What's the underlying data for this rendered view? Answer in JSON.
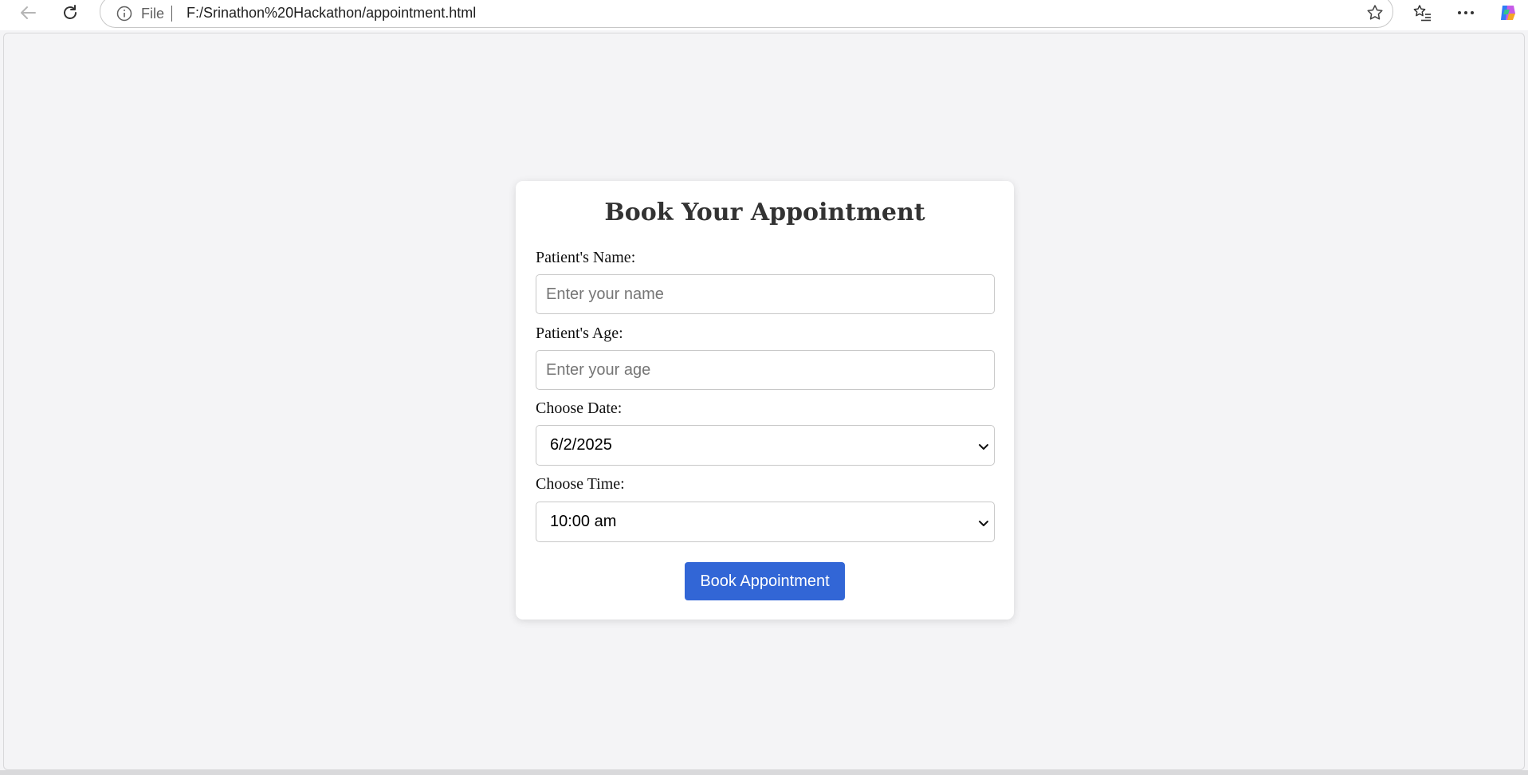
{
  "browser": {
    "file_label": "File",
    "url": "F:/Srinathon%20Hackathon/appointment.html"
  },
  "form": {
    "title": "Book Your Appointment",
    "name_label": "Patient's Name:",
    "name_placeholder": "Enter your name",
    "age_label": "Patient's Age:",
    "age_placeholder": "Enter your age",
    "date_label": "Choose Date:",
    "date_value": "6/2/2025",
    "time_label": "Choose Time:",
    "time_value": "10:00 am",
    "submit_label": "Book Appointment"
  },
  "colors": {
    "accent": "#3266d6",
    "page_bg": "#f4f4f6",
    "card_bg": "#ffffff"
  }
}
